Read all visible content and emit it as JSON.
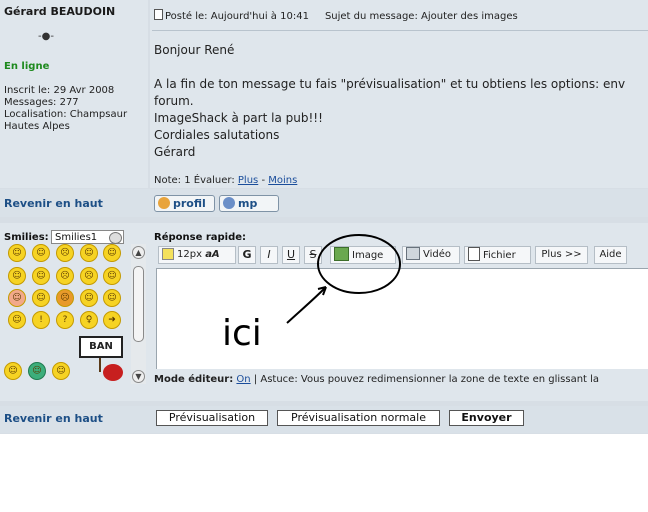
{
  "author": {
    "name": "Gérard BEAUDOIN",
    "status": "En ligne",
    "info_lines": [
      "Inscrit le: 29 Avr 2008",
      "Messages: 277",
      "Localisation: Champsaur",
      "Hautes Alpes"
    ]
  },
  "post": {
    "date": "Posté le: Aujourd'hui à 10:41",
    "subject": "Sujet du message: Ajouter des images",
    "body_lines": [
      "Bonjour René",
      "",
      "A la fin de ton message tu fais \"prévisualisation\" et tu obtiens les options: env",
      "forum.",
      "ImageShack à part la pub!!!",
      "Cordiales salutations",
      "Gérard"
    ],
    "note_label": "Note: 1  Évaluer:",
    "rate_plus": "Plus",
    "rate_separator": "-",
    "rate_minus": "Moins"
  },
  "nav": {
    "back_to_top": "Revenir en haut",
    "profile_button": "profil",
    "pm_button": "mp"
  },
  "smilies": {
    "label": "Smilies:",
    "selected": "Smilies1"
  },
  "quick_reply": {
    "title": "Réponse rapide:",
    "font_size": "12px",
    "font_label": "aA",
    "bold": "G",
    "italic": "I",
    "strike": "S",
    "underline": "U",
    "image_button": "Image",
    "video_button": "Vidéo",
    "file_button": "Fichier",
    "more_button": "Plus >>",
    "help_button": "Aide",
    "editor_mode_label": "Mode éditeur:",
    "editor_mode_value": "On",
    "tip": "| Astuce: Vous pouvez redimensionner la zone de texte en glissant la"
  },
  "annotation": {
    "text": "ici"
  },
  "footer": {
    "preview": "Prévisualisation",
    "preview_normal": "Prévisualisation normale",
    "send": "Envoyer"
  },
  "colors": {
    "link": "#1d4f86",
    "online": "#1e8a1e",
    "panel": "#dfe6ec"
  }
}
